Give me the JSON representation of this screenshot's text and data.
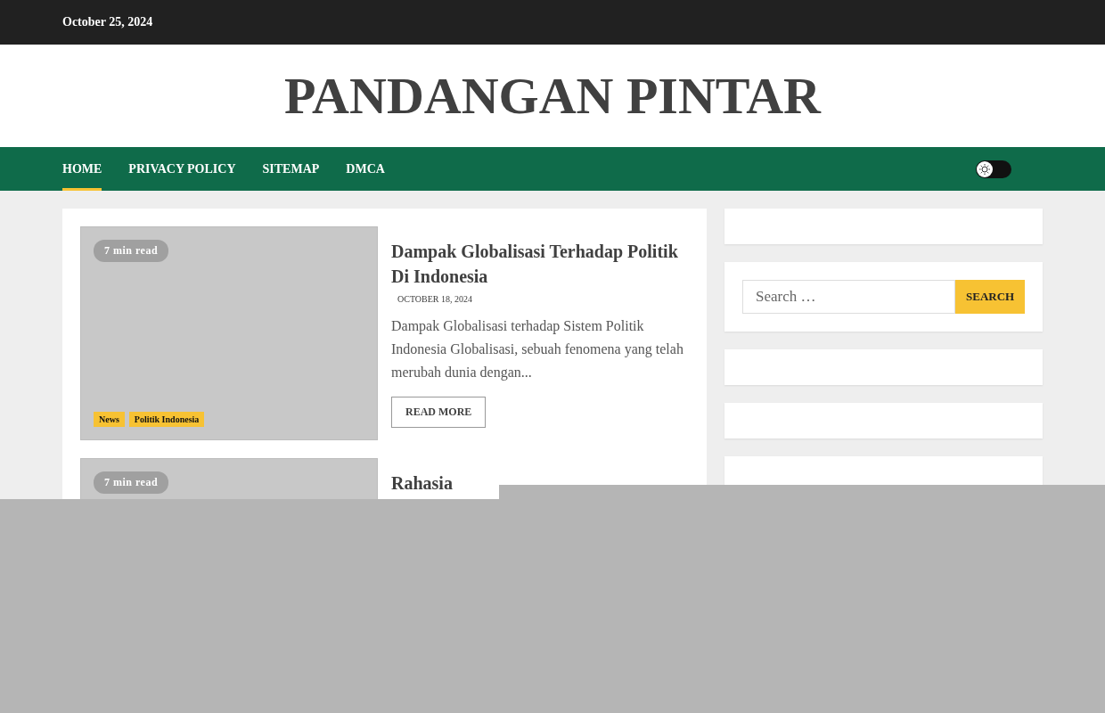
{
  "top_bar": {
    "date": "October 25, 2024"
  },
  "site_title": "PANDANGAN PINTAR",
  "nav": {
    "items": [
      {
        "label": "HOME",
        "selected": true
      },
      {
        "label": "PRIVACY POLICY",
        "selected": false
      },
      {
        "label": "SITEMAP",
        "selected": false
      },
      {
        "label": "DMCA",
        "selected": false
      }
    ],
    "dark_mode_toggle": {
      "on": false
    }
  },
  "articles": [
    {
      "read_time": "7 min read",
      "title": "Dampak Globalisasi Terhadap Politik Di Indonesia",
      "date": "OCTOBER 18, 2024",
      "excerpt": "Dampak Globalisasi terhadap Sistem Politik Indonesia Globalisasi, sebuah fenomena yang telah merubah dunia dengan...",
      "tags": [
        "News",
        "Politik Indonesia"
      ],
      "button": "READ MORE"
    },
    {
      "read_time": "7 min read",
      "title": "Rahasia"
    }
  ],
  "sidebar": {
    "search": {
      "placeholder": "Search …",
      "button": "SEARCH"
    }
  }
}
